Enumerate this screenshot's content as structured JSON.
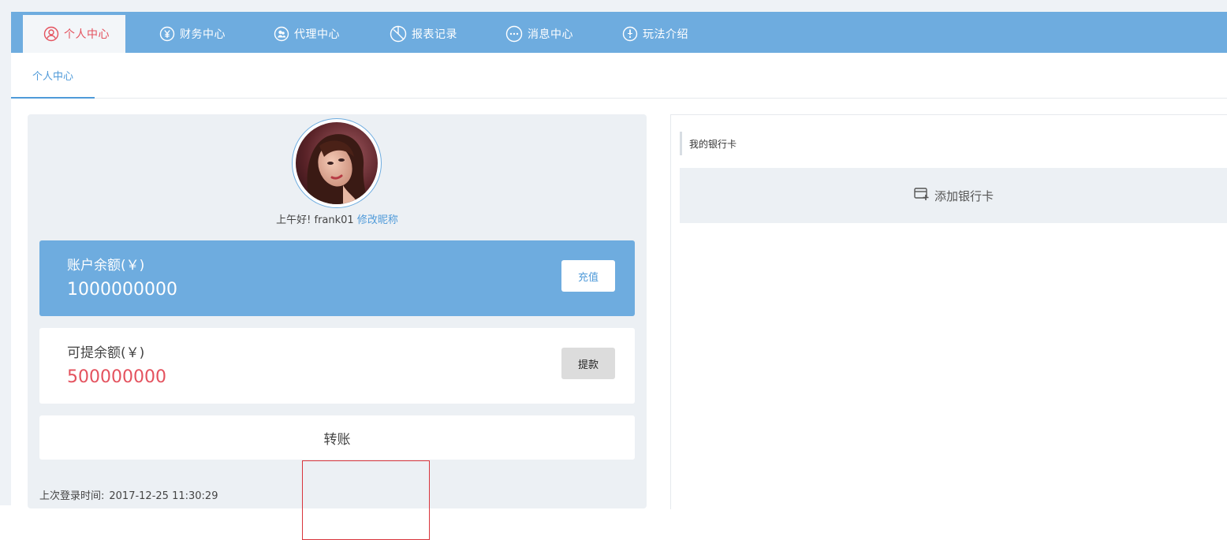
{
  "nav": {
    "items": [
      {
        "label": "个人中心",
        "icon": "user-icon",
        "active": true
      },
      {
        "label": "财务中心",
        "icon": "yuan-icon"
      },
      {
        "label": "代理中心",
        "icon": "agent-icon"
      },
      {
        "label": "报表记录",
        "icon": "pie-chart-icon"
      },
      {
        "label": "消息中心",
        "icon": "message-icon"
      },
      {
        "label": "玩法介绍",
        "icon": "info-icon"
      }
    ]
  },
  "subtabs": [
    {
      "label": "个人中心"
    }
  ],
  "profile": {
    "greeting": "上午好!",
    "username": "frank01",
    "edit_nickname": "修改昵称"
  },
  "balance": {
    "label": "账户余额(￥)",
    "value": "1000000000",
    "recharge_label": "充值"
  },
  "withdrawable": {
    "label": "可提余额(￥)",
    "value": "500000000",
    "withdraw_label": "提款"
  },
  "transfer": {
    "label": "转账"
  },
  "last_login": {
    "label": "上次登录时间:",
    "time": "2017-12-25 11:30:29"
  },
  "bank": {
    "title": "我的银行卡",
    "add_label": "添加银行卡"
  },
  "colors": {
    "nav_bg": "#6eacdf",
    "accent_red": "#e4525e",
    "accent_blue": "#4f9ad9"
  }
}
